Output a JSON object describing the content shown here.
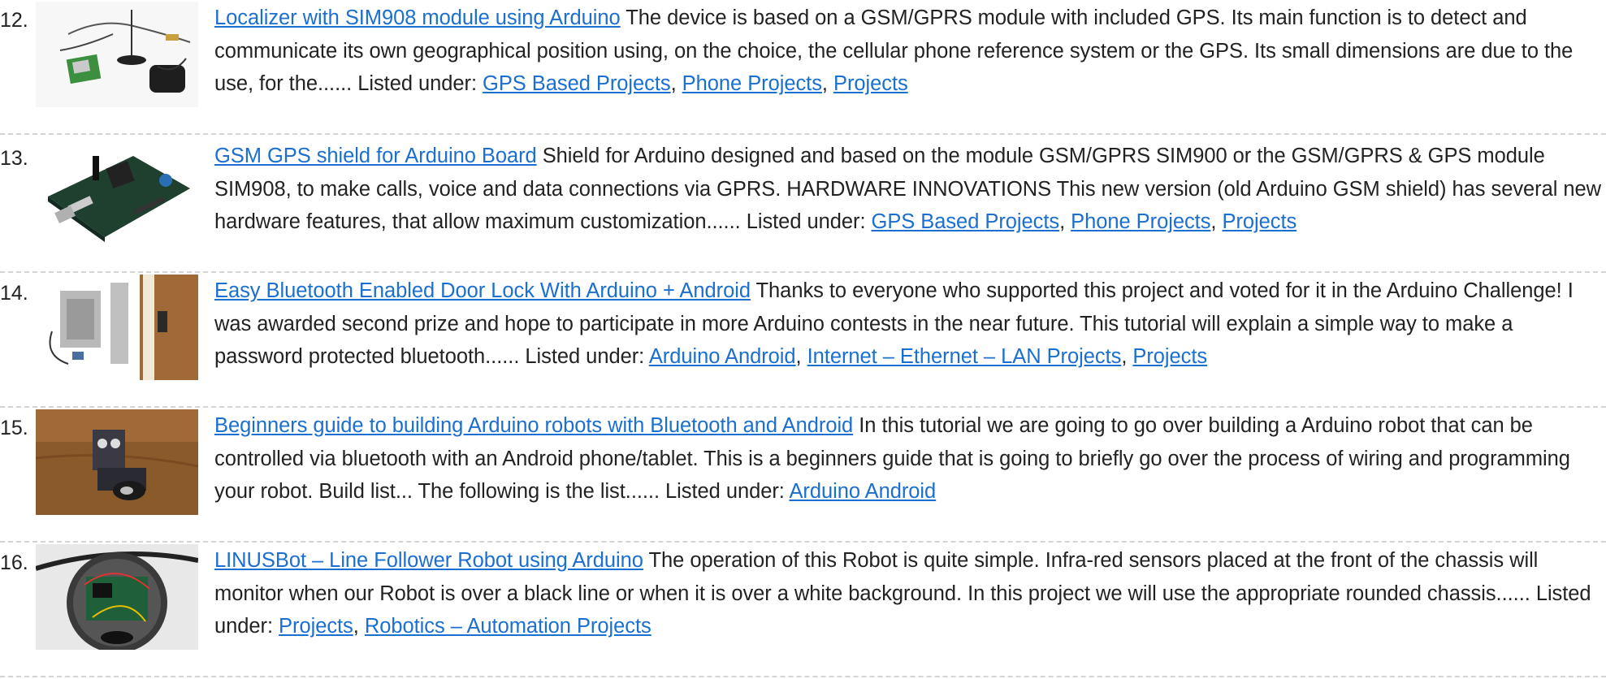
{
  "items": [
    {
      "number": "12.",
      "title": "Localizer with SIM908 module using Arduino",
      "description": " The device is based on a GSM/GPRS module with included GPS. Its main function is to detect and communicate its own geographical position using, on the choice, the cellular phone reference system or the GPS. Its small dimensions are due to the use, for the...... ",
      "listed_under": "Listed under: ",
      "categories": [
        "GPS Based Projects",
        "Phone Projects",
        "Projects"
      ]
    },
    {
      "number": "13.",
      "title": "GSM GPS shield for Arduino Board",
      "description": " Shield for Arduino designed and based on the module GSM/GPRS SIM900 or the GSM/GPRS & GPS module SIM908, to make calls, voice and data connections via GPRS. HARDWARE INNOVATIONS This new version (old Arduino GSM shield) has several new hardware features, that allow maximum customization...... ",
      "listed_under": "Listed under: ",
      "categories": [
        "GPS Based Projects",
        "Phone Projects",
        "Projects"
      ]
    },
    {
      "number": "14.",
      "title": "Easy Bluetooth Enabled Door Lock With Arduino + Android",
      "description": " Thanks to everyone who supported this project and voted for it in the Arduino Challenge! I was awarded second prize and hope to participate in more Arduino contests in the near future. This tutorial will explain a simple way to make a password protected bluetooth...... ",
      "listed_under": "Listed under: ",
      "categories": [
        "Arduino Android",
        "Internet – Ethernet – LAN Projects",
        "Projects"
      ]
    },
    {
      "number": "15.",
      "title": "Beginners guide to building Arduino robots with Bluetooth and Android",
      "description": " In this tutorial we are going to go over building a Arduino robot that can be controlled via bluetooth with an Android phone/tablet. This is a beginners guide that is going to briefly go over the process of wiring and programming your robot. Build list... The following is the list...... ",
      "listed_under": "Listed under: ",
      "categories": [
        "Arduino Android"
      ]
    },
    {
      "number": "16.",
      "title": "LINUSBot – Line Follower Robot using Arduino",
      "description": " The operation of this Robot is quite simple. Infra-red sensors placed at the front of the chassis  will monitor when our Robot is over a black line or when it is over a white background. In this project we will use the appropriate rounded chassis...... ",
      "listed_under": "Listed under: ",
      "categories": [
        "Projects",
        "Robotics – Automation Projects"
      ]
    }
  ],
  "separator": ", ",
  "colors": {
    "link": "#1a6fd1",
    "text": "#222222",
    "divider": "#d4d4d4"
  }
}
